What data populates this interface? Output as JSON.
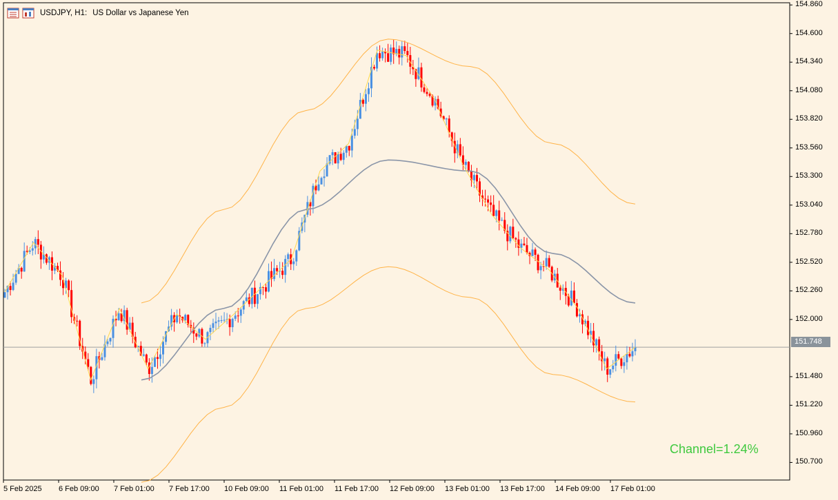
{
  "window": {
    "symbol": "USDJPY, H1:",
    "description": "US Dollar vs Japanese Yen",
    "icons": [
      "window-menu-icon",
      "chart-type-icon"
    ]
  },
  "colors": {
    "background": "#fdf3e3",
    "bull_candle": "#4a90e2",
    "bear_candle": "#ff0000",
    "channel_band": "#ffb347",
    "channel_mid": "#8a95a8",
    "price_path": "#ffd84d",
    "current_price_line": "#a0a0a0",
    "channel_label": "#3ec93e"
  },
  "price_axis": {
    "ticks": [
      "154.860",
      "154.600",
      "154.340",
      "154.080",
      "153.820",
      "153.560",
      "153.300",
      "153.040",
      "152.780",
      "152.520",
      "152.260",
      "152.000",
      "151.748",
      "151.480",
      "151.220",
      "150.960",
      "150.700"
    ],
    "current_price": "151.748"
  },
  "time_axis": {
    "ticks": [
      "5 Feb 2025",
      "6 Feb 09:00",
      "7 Feb 01:00",
      "7 Feb 17:00",
      "10 Feb 09:00",
      "11 Feb 01:00",
      "11 Feb 17:00",
      "12 Feb 09:00",
      "13 Feb 01:00",
      "13 Feb 17:00",
      "14 Feb 09:00",
      "17 Feb 01:00"
    ]
  },
  "indicator": {
    "channel_label": "Channel=1.24%"
  },
  "chart_data": {
    "type": "candlestick",
    "title": "USDJPY, H1:  US Dollar vs Japanese Yen",
    "ylim": [
      150.54,
      154.88
    ],
    "x_labels": [
      "5 Feb 2025",
      "6 Feb 09:00",
      "7 Feb 01:00",
      "7 Feb 17:00",
      "10 Feb 09:00",
      "11 Feb 01:00",
      "11 Feb 17:00",
      "12 Feb 09:00",
      "13 Feb 01:00",
      "13 Feb 17:00",
      "14 Feb 09:00",
      "17 Feb 01:00"
    ],
    "key_closes": [
      152.25,
      152.7,
      152.4,
      151.45,
      152.1,
      151.55,
      152.05,
      151.82,
      152.05,
      152.3,
      152.55,
      153.35,
      153.6,
      154.45,
      154.4,
      154.0,
      153.4,
      152.95,
      152.65,
      152.45,
      152.1,
      151.55,
      151.748
    ],
    "series": [
      {
        "name": "Channel upper",
        "values": [
          152.15,
          153.0,
          153.9,
          154.55,
          154.3,
          153.6,
          153.05
        ]
      },
      {
        "name": "Channel middle",
        "values": [
          151.45,
          152.1,
          153.0,
          153.45,
          153.35,
          152.6,
          152.15
        ]
      },
      {
        "name": "Channel lower",
        "values": [
          150.52,
          151.2,
          152.1,
          152.48,
          152.2,
          151.5,
          151.25
        ]
      }
    ]
  }
}
